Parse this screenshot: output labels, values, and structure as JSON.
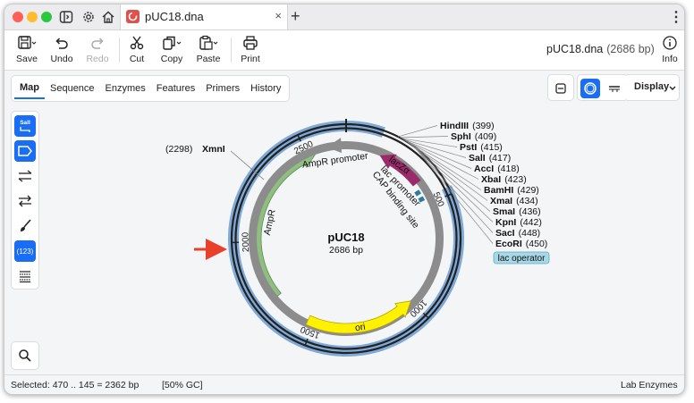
{
  "window": {
    "tab_title": "pUC18.dna",
    "tab_close": "×",
    "new_tab": "+",
    "menu": "⋮"
  },
  "toolbar": {
    "save": "Save",
    "undo": "Undo",
    "redo": "Redo",
    "cut": "Cut",
    "copy": "Copy",
    "paste": "Paste",
    "print": "Print",
    "info": "Info",
    "doc_name": "pUC18.dna",
    "doc_length": "(2686 bp)"
  },
  "view_tabs": [
    "Map",
    "Sequence",
    "Enzymes",
    "Features",
    "Primers",
    "History"
  ],
  "active_view": "Map",
  "display_label": "Display",
  "palette": {
    "sali_label": "SalI",
    "numbers_label": "(123)"
  },
  "map": {
    "name": "pUC18",
    "length": "2686 bp",
    "ticks": [
      "500",
      "1000",
      "1500",
      "2000",
      "2500"
    ],
    "features": {
      "ampr_promoter": "AmpR promoter",
      "ampr": "AmpR",
      "lacza": "lacZα",
      "lac_promoter": "lac promoter",
      "cap_site": "CAP binding site",
      "ori": "ori",
      "lac_operator": "lac operator"
    },
    "enzymes": [
      {
        "name": "HindIII",
        "pos": "(399)"
      },
      {
        "name": "SphI",
        "pos": "(409)"
      },
      {
        "name": "PstI",
        "pos": "(415)"
      },
      {
        "name": "SalI",
        "pos": "(417)"
      },
      {
        "name": "AccI",
        "pos": "(418)"
      },
      {
        "name": "XbaI",
        "pos": "(423)"
      },
      {
        "name": "BamHI",
        "pos": "(429)"
      },
      {
        "name": "XmaI",
        "pos": "(434)"
      },
      {
        "name": "SmaI",
        "pos": "(436)"
      },
      {
        "name": "KpnI",
        "pos": "(442)"
      },
      {
        "name": "SacI",
        "pos": "(448)"
      },
      {
        "name": "EcoRI",
        "pos": "(450)"
      }
    ],
    "xmni": {
      "name": "XmnI",
      "pos": "(2298)"
    }
  },
  "status": {
    "selected": "Selected:  470 .. 145  =  2362 bp",
    "gc": "[50% GC]",
    "enzyme_set": "Lab Enzymes"
  },
  "colors": {
    "accent": "#1a6ef5",
    "selection_arc": "#7fa9d6",
    "ampr": "#8fbf7f",
    "ori": "#fff200",
    "lacza": "#9a2a6a",
    "promoter": "#8c8c8c",
    "lac_operator": "#a8d8e6",
    "pointer_arrow": "#e8402a"
  }
}
